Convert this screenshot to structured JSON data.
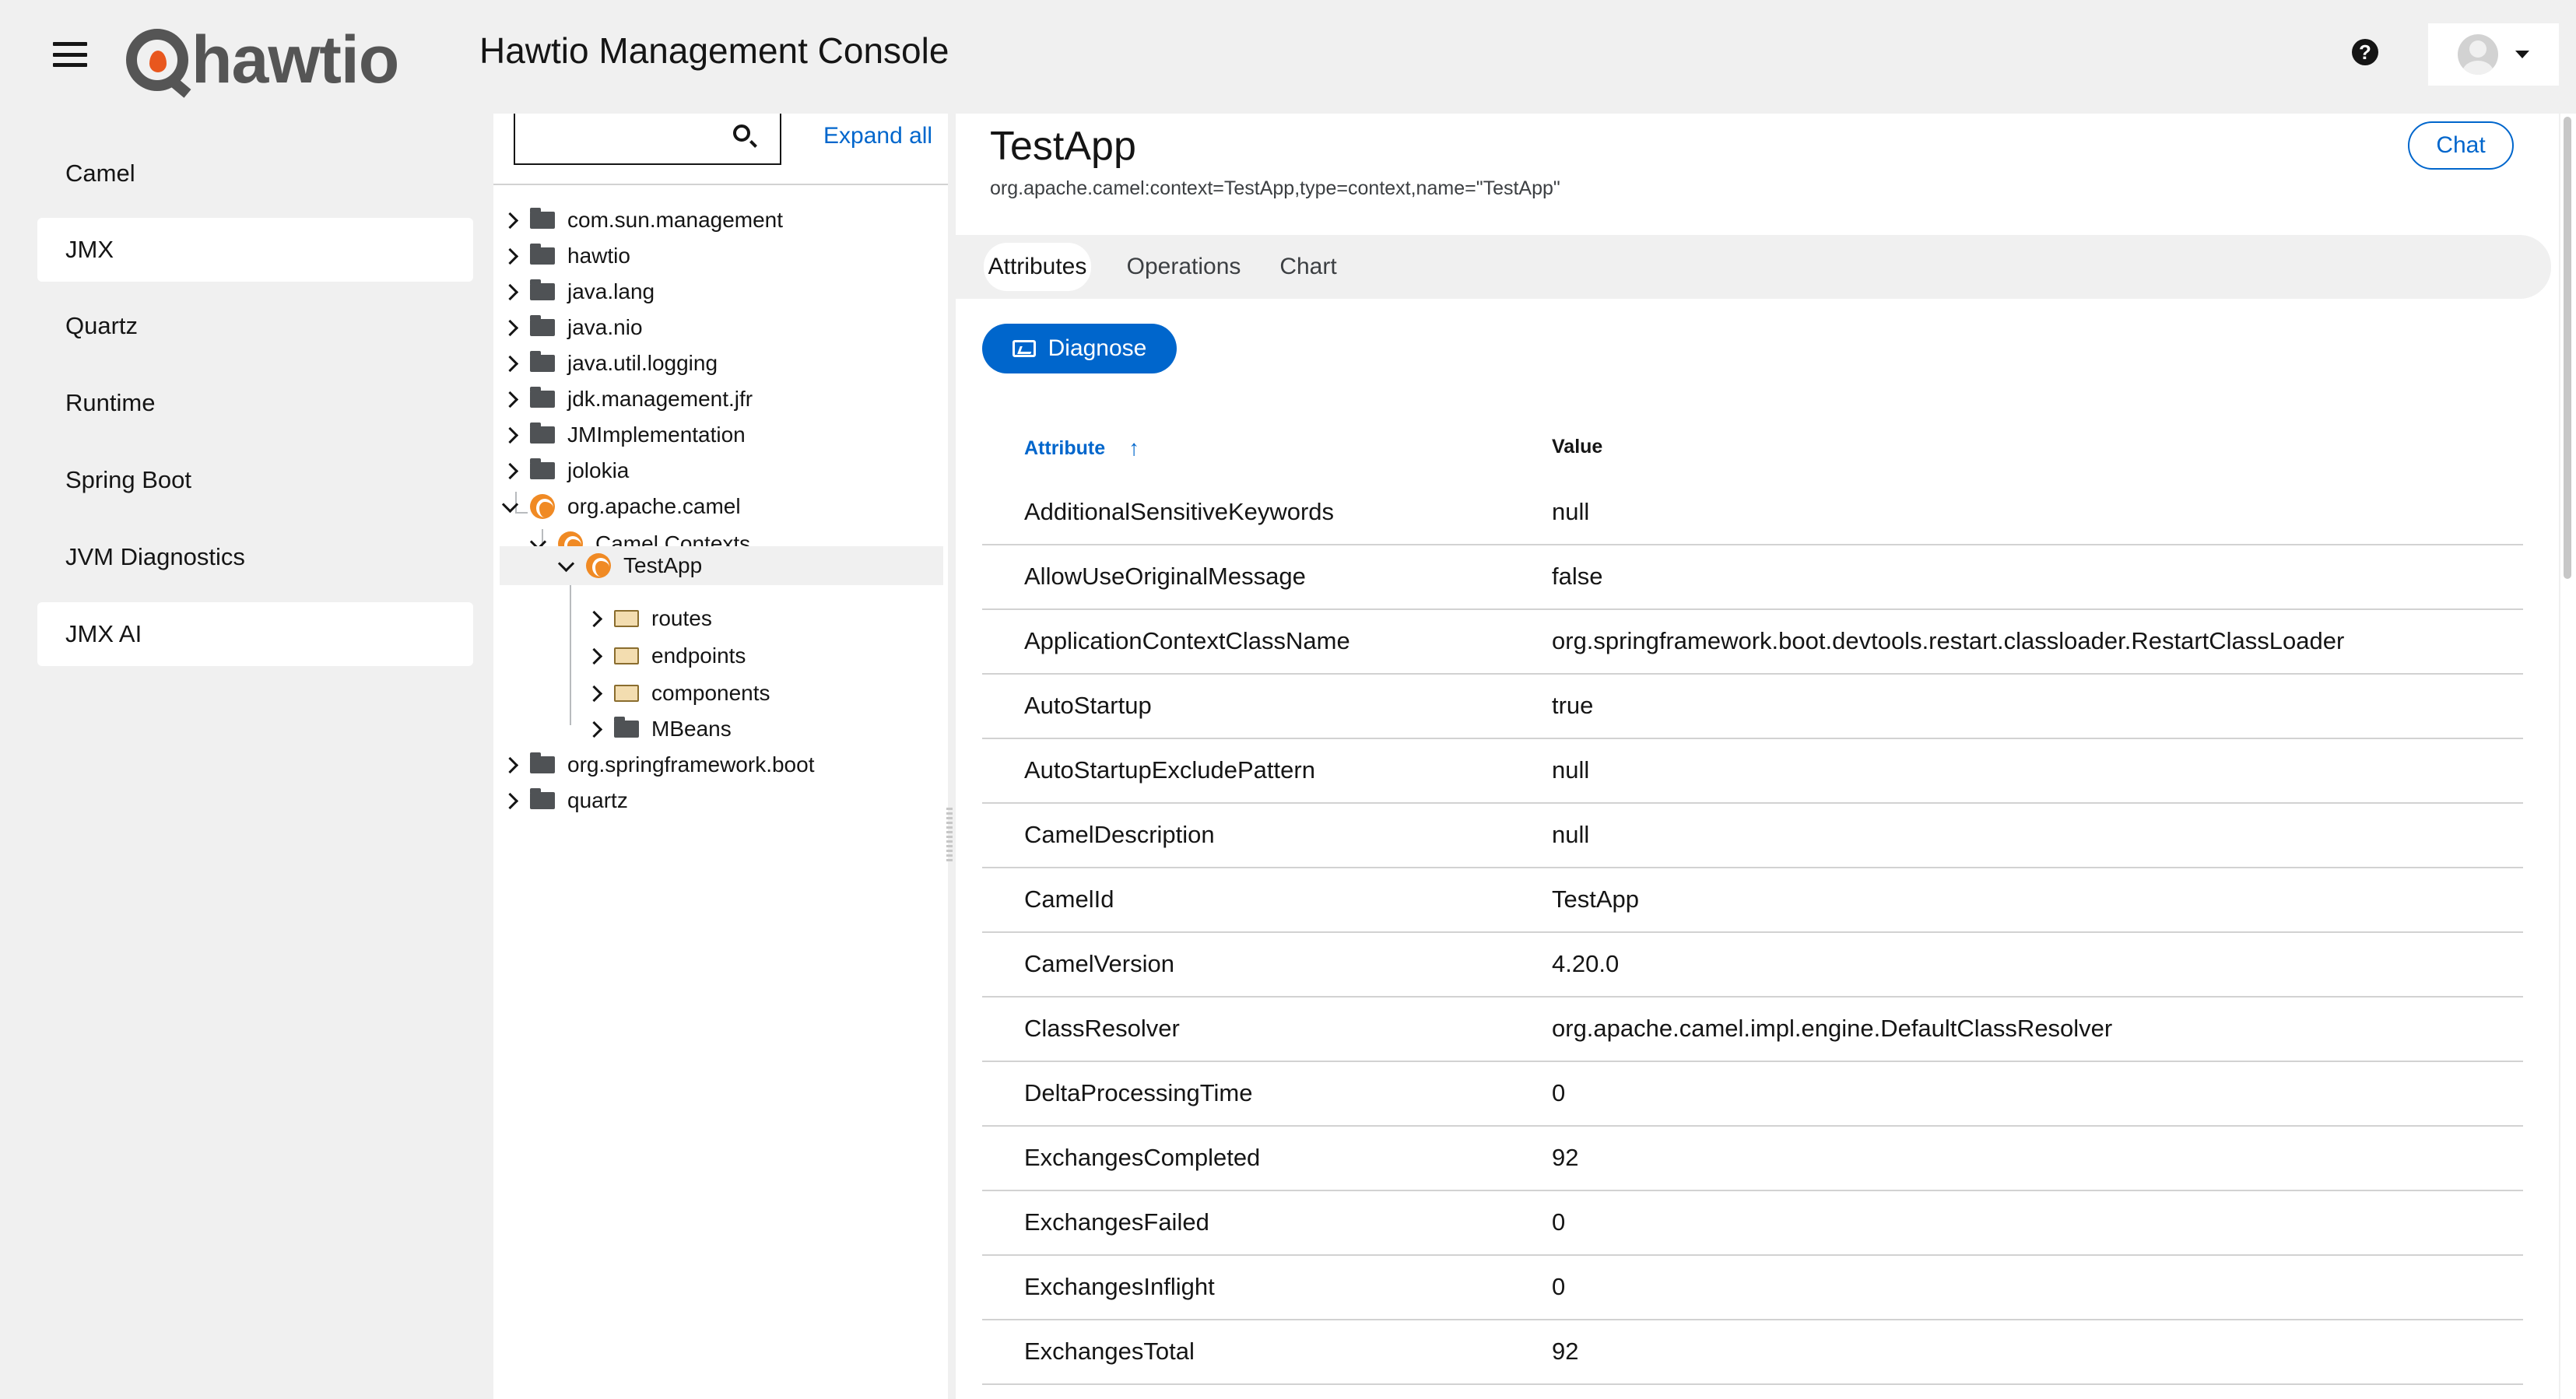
{
  "header": {
    "brand": "hawtio",
    "title": "Hawtio Management Console",
    "help_glyph": "?"
  },
  "sidebar": {
    "items": [
      {
        "label": "Camel",
        "active": false
      },
      {
        "label": "JMX",
        "active": true
      },
      {
        "label": "Quartz",
        "active": false
      },
      {
        "label": "Runtime",
        "active": false
      },
      {
        "label": "Spring Boot",
        "active": false
      },
      {
        "label": "JVM Diagnostics",
        "active": false
      },
      {
        "label": "JMX AI",
        "active": true
      }
    ]
  },
  "tree": {
    "search_placeholder": "",
    "expand_all": "Expand all",
    "nodes": [
      {
        "label": "com.sun.management",
        "icon": "folder-icon"
      },
      {
        "label": "hawtio",
        "icon": "folder-icon"
      },
      {
        "label": "java.lang",
        "icon": "folder-icon"
      },
      {
        "label": "java.nio",
        "icon": "folder-icon"
      },
      {
        "label": "java.util.logging",
        "icon": "folder-icon"
      },
      {
        "label": "jdk.management.jfr",
        "icon": "folder-icon"
      },
      {
        "label": "JMImplementation",
        "icon": "folder-icon"
      },
      {
        "label": "jolokia",
        "icon": "folder-icon"
      },
      {
        "label": "org.apache.camel",
        "icon": "camel-icon",
        "expanded": true
      },
      {
        "label": "Camel Contexts",
        "icon": "camel-icon",
        "expanded": true
      },
      {
        "label": "TestApp",
        "icon": "camel-icon",
        "expanded": true,
        "selected": true
      },
      {
        "label": "routes",
        "icon": "folder-open-icon"
      },
      {
        "label": "endpoints",
        "icon": "folder-open-icon"
      },
      {
        "label": "components",
        "icon": "folder-open-icon"
      },
      {
        "label": "MBeans",
        "icon": "folder-icon"
      },
      {
        "label": "org.springframework.boot",
        "icon": "folder-icon"
      },
      {
        "label": "quartz",
        "icon": "folder-icon"
      }
    ]
  },
  "main": {
    "title": "TestApp",
    "object_name": "org.apache.camel:context=TestApp,type=context,name=\"TestApp\"",
    "chat_label": "Chat",
    "tabs": [
      {
        "label": "Attributes",
        "active": true
      },
      {
        "label": "Operations",
        "active": false
      },
      {
        "label": "Chart",
        "active": false
      }
    ],
    "diagnose_label": "Diagnose",
    "columns": {
      "attribute": "Attribute",
      "value": "Value",
      "sort_glyph": "↑"
    },
    "rows": [
      {
        "attribute": "AdditionalSensitiveKeywords",
        "value": "null"
      },
      {
        "attribute": "AllowUseOriginalMessage",
        "value": "false"
      },
      {
        "attribute": "ApplicationContextClassName",
        "value": "org.springframework.boot.devtools.restart.classloader.RestartClassLoader"
      },
      {
        "attribute": "AutoStartup",
        "value": "true"
      },
      {
        "attribute": "AutoStartupExcludePattern",
        "value": "null"
      },
      {
        "attribute": "CamelDescription",
        "value": "null"
      },
      {
        "attribute": "CamelId",
        "value": "TestApp"
      },
      {
        "attribute": "CamelVersion",
        "value": "4.20.0"
      },
      {
        "attribute": "ClassResolver",
        "value": "org.apache.camel.impl.engine.DefaultClassResolver"
      },
      {
        "attribute": "DeltaProcessingTime",
        "value": "0"
      },
      {
        "attribute": "ExchangesCompleted",
        "value": "92"
      },
      {
        "attribute": "ExchangesFailed",
        "value": "0"
      },
      {
        "attribute": "ExchangesInflight",
        "value": "0"
      },
      {
        "attribute": "ExchangesTotal",
        "value": "92"
      }
    ]
  },
  "colors": {
    "accent": "#0066cc",
    "page_bg": "#f0f0f0",
    "camel_orange": "#f08a24"
  }
}
